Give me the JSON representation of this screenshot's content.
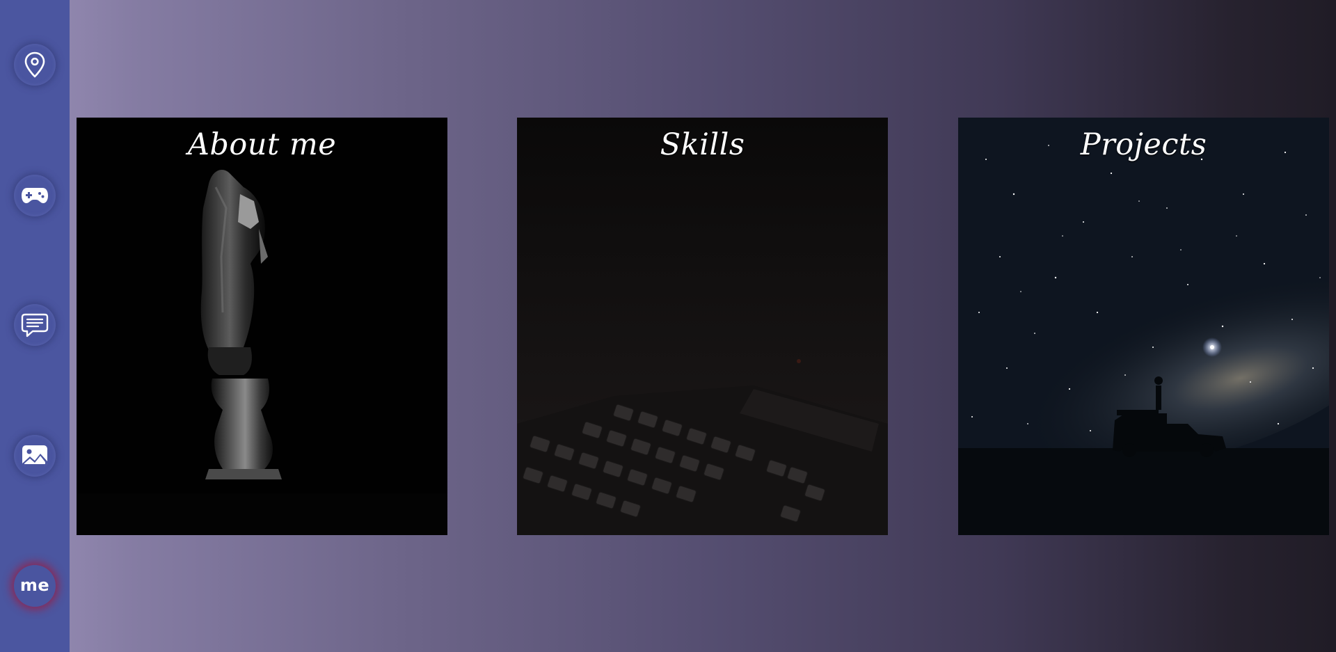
{
  "sidebar": {
    "items": [
      {
        "icon": "location-pin-icon"
      },
      {
        "icon": "gamepad-icon"
      },
      {
        "icon": "chat-icon"
      },
      {
        "icon": "image-icon"
      },
      {
        "icon": "me-avatar",
        "label": "me"
      }
    ]
  },
  "cards": [
    {
      "title": "About me",
      "image": "chess-knight-icon"
    },
    {
      "title": "Skills",
      "image": "keyboard-icon"
    },
    {
      "title": "Projects",
      "image": "starry-sky-icon"
    }
  ],
  "colors": {
    "sidebar": "#4b56a0",
    "button": "#4a55a0",
    "me_glow": "#961e46",
    "gradient_start": "#9a90b8",
    "gradient_end": "#201c26"
  }
}
